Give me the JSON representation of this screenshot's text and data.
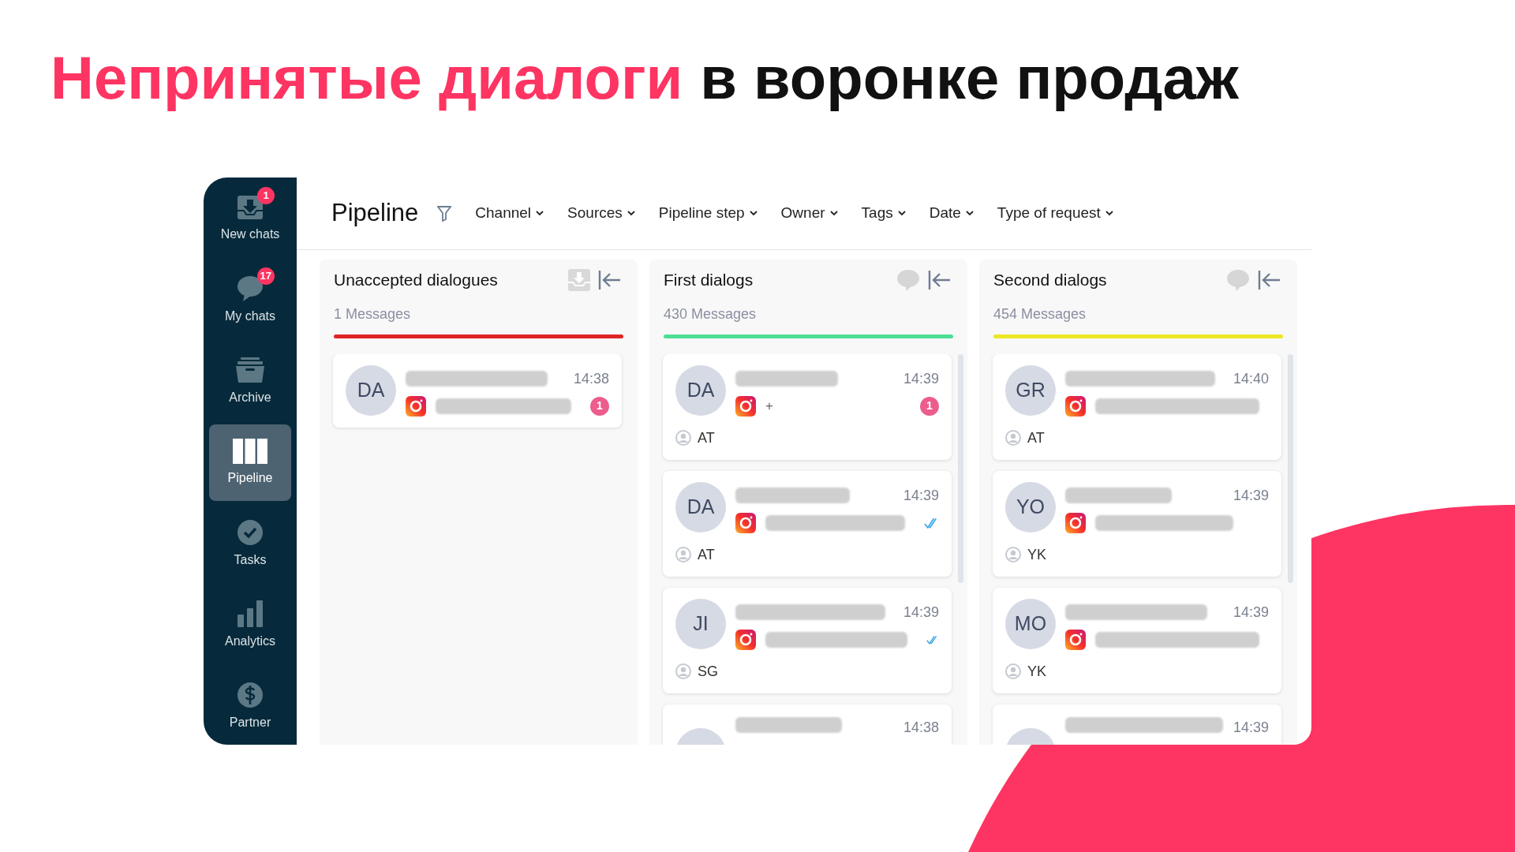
{
  "headline": [
    {
      "text": "Непринятые диалоги",
      "accent": true
    },
    {
      "text": "в воронке продаж",
      "accent": false
    }
  ],
  "sidebar": {
    "items": [
      {
        "kind": "inbox",
        "label": "New chats",
        "badge": "1",
        "selected": false
      },
      {
        "kind": "chat",
        "label": "My chats",
        "badge": "17",
        "selected": false
      },
      {
        "kind": "archive",
        "label": "Archive",
        "selected": false
      },
      {
        "kind": "pipeline",
        "label": "Pipeline",
        "selected": true
      },
      {
        "kind": "tasks",
        "label": "Tasks",
        "selected": false
      },
      {
        "kind": "analytics",
        "label": "Analytics",
        "selected": false
      },
      {
        "kind": "partner",
        "label": "Partner",
        "selected": false
      }
    ]
  },
  "header": {
    "title": "Pipeline",
    "filters": [
      "Channel",
      "Sources",
      "Pipeline step",
      "Owner",
      "Tags",
      "Date",
      "Type of request"
    ]
  },
  "columns": [
    {
      "title": "Unaccepted dialogues",
      "count": "1 Messages",
      "color": "#e02424",
      "action": {
        "kind": "inbox"
      },
      "scrollbar": false,
      "cards": [
        {
          "kind": "full",
          "initials": "DA",
          "time": "14:38",
          "unread": "1",
          "read": false
        }
      ]
    },
    {
      "title": "First dialogs",
      "count": "430 Messages",
      "color": "#4cde94",
      "action": {
        "kind": "chat"
      },
      "scrollbar": true,
      "cards": [
        {
          "kind": "full",
          "initials": "DA",
          "time": "14:39",
          "note": "+",
          "unread": "1",
          "read": false,
          "assignee": "AT"
        },
        {
          "kind": "full",
          "initials": "DA",
          "time": "14:39",
          "read": true,
          "assignee": "AT"
        },
        {
          "kind": "full",
          "initials": "JI",
          "time": "14:39",
          "read": true,
          "assignee": "SG"
        },
        {
          "kind": "cut",
          "time": "14:38"
        }
      ]
    },
    {
      "title": "Second dialogs",
      "count": "454 Messages",
      "color": "#ece625",
      "action": {
        "kind": "chat"
      },
      "scrollbar": true,
      "cards": [
        {
          "kind": "full",
          "initials": "GR",
          "time": "14:40",
          "read": false,
          "assignee": "AT"
        },
        {
          "kind": "full",
          "initials": "YO",
          "time": "14:39",
          "read": false,
          "assignee": "YK"
        },
        {
          "kind": "full",
          "initials": "MO",
          "time": "14:39",
          "read": false,
          "assignee": "YK"
        },
        {
          "kind": "cut",
          "time": "14:39"
        }
      ]
    }
  ]
}
